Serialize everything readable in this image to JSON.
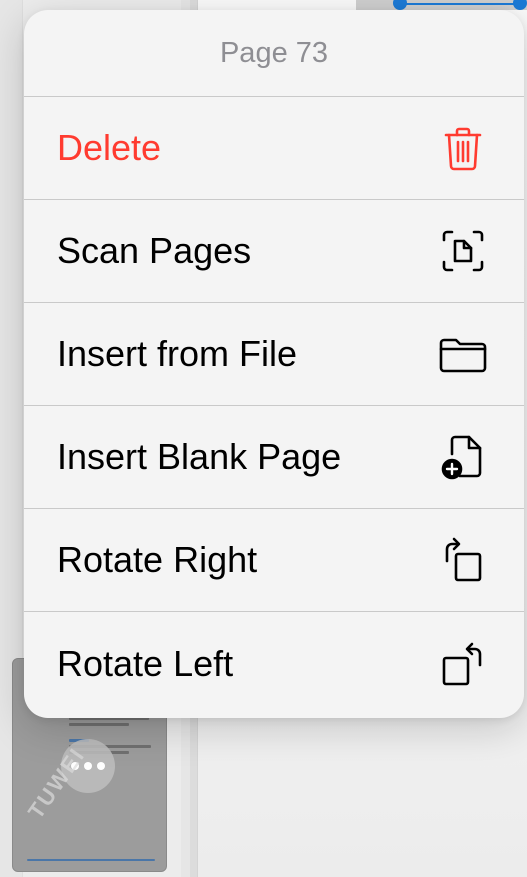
{
  "menu": {
    "title": "Page 73",
    "items": [
      {
        "label": "Delete",
        "icon": "trash-icon",
        "destructive": true
      },
      {
        "label": "Scan Pages",
        "icon": "scan-document-icon",
        "destructive": false
      },
      {
        "label": "Insert from File",
        "icon": "folder-icon",
        "destructive": false
      },
      {
        "label": "Insert Blank Page",
        "icon": "add-page-icon",
        "destructive": false
      },
      {
        "label": "Rotate Right",
        "icon": "rotate-right-icon",
        "destructive": false
      },
      {
        "label": "Rotate Left",
        "icon": "rotate-left-icon",
        "destructive": false
      }
    ]
  },
  "thumbnail": {
    "watermark": "TUWEI"
  },
  "colors": {
    "destructive": "#ff3b30",
    "title_gray": "#8e8e93",
    "accent_blue": "#1c7ad6"
  }
}
